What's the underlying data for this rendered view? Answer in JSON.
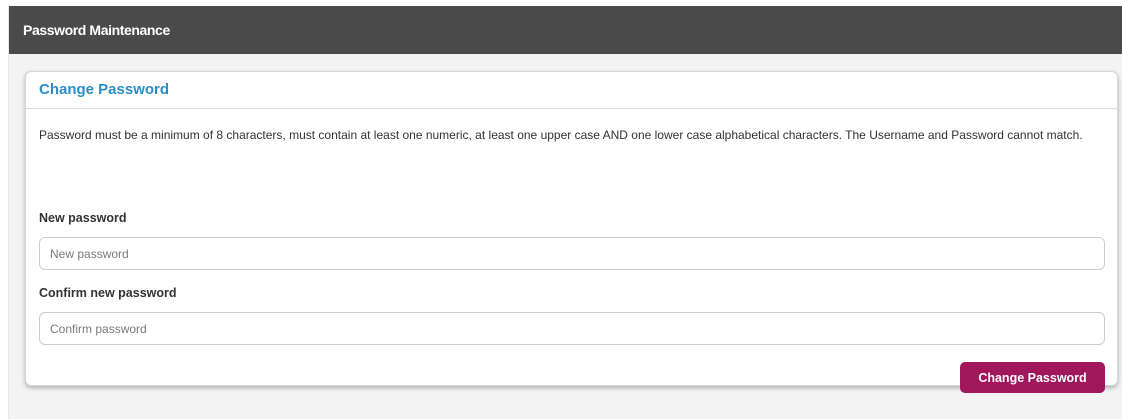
{
  "titlebar": {
    "title": "Password Maintenance"
  },
  "panel": {
    "title": "Change Password",
    "rules": "Password must be a minimum of 8 characters, must contain at least one numeric, at least one upper case AND one lower case alphabetical characters. The Username and Password cannot match.",
    "new_password": {
      "label": "New password",
      "placeholder": "New password",
      "value": ""
    },
    "confirm_password": {
      "label": "Confirm new password",
      "placeholder": "Confirm password",
      "value": ""
    },
    "submit_label": "Change Password"
  },
  "colors": {
    "titlebar_bg": "#4a4a4a",
    "panel_title": "#2a8dc6",
    "button_bg": "#a0175c",
    "page_bg": "#f3f3f3"
  }
}
